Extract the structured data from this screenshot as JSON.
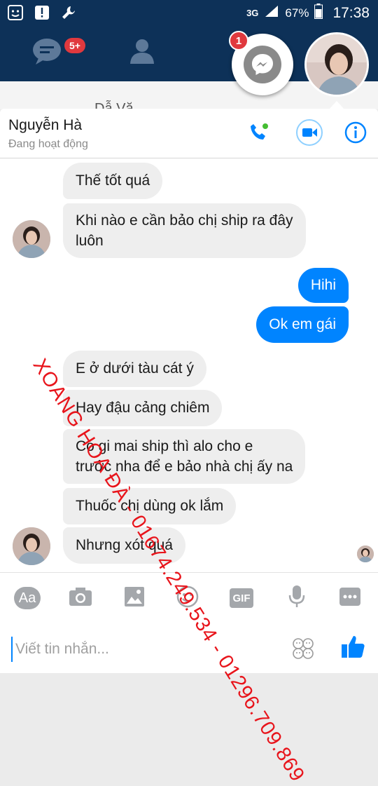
{
  "status_bar": {
    "network": "3G",
    "battery": "67%",
    "time": "17:38"
  },
  "facebook_tabs": {
    "messages_badge": "5+"
  },
  "messenger_head": {
    "badge": "1"
  },
  "background_chat": {
    "name_partial": "Dẫ Vă"
  },
  "chat_header": {
    "name": "Nguyễn Hà",
    "status": "Đang hoạt động"
  },
  "messages": [
    {
      "dir": "in",
      "text": "Thế tốt quá"
    },
    {
      "dir": "in",
      "text": "Khi nào e cần bảo chị ship ra đây\nluôn"
    },
    {
      "dir": "out",
      "text": "Hihi"
    },
    {
      "dir": "out",
      "text": "Ok em gái"
    },
    {
      "dir": "in",
      "text": "E ở dưới tàu cát ý"
    },
    {
      "dir": "in",
      "text": "Hay đậu cảng chiêm"
    },
    {
      "dir": "in",
      "text": "Có gi mai ship thì alo cho e\ntrước nha để e bảo nhà chị ấy na"
    },
    {
      "dir": "in",
      "text": "Thuốc chị dùng ok lắm"
    },
    {
      "dir": "in",
      "text": "Nhưng xót quá"
    }
  ],
  "composer": {
    "aa_label": "Aa",
    "gif_label": "GIF",
    "placeholder": "Viết tin nhắn..."
  },
  "watermark": "XOANG HOA ĐÀ - 01674.249.534 - 01296.709.869",
  "colors": {
    "brand_dark": "#0d3158",
    "outgoing": "#0084ff",
    "incoming": "#eeeeee",
    "badge": "#e0393e",
    "watermark": "#e8141b"
  }
}
